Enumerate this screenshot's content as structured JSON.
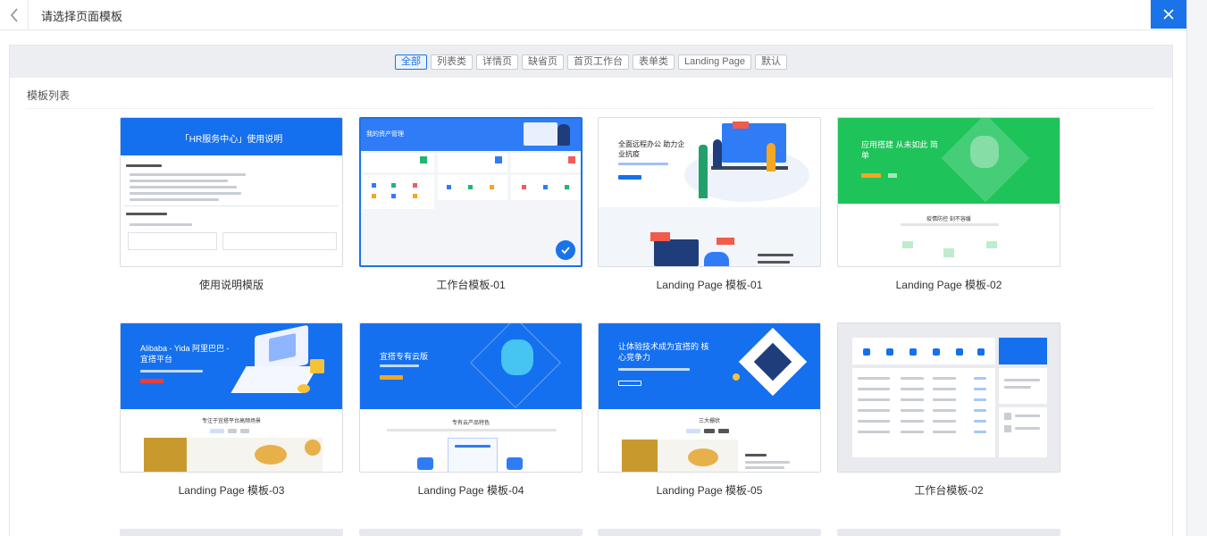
{
  "header": {
    "title": "请选择页面模板"
  },
  "tabs": [
    {
      "label": "全部",
      "active": true
    },
    {
      "label": "列表类",
      "active": false
    },
    {
      "label": "详情页",
      "active": false
    },
    {
      "label": "缺省页",
      "active": false
    },
    {
      "label": "首页工作台",
      "active": false
    },
    {
      "label": "表单类",
      "active": false
    },
    {
      "label": "Landing Page",
      "active": false
    },
    {
      "label": "默认",
      "active": false
    }
  ],
  "section": {
    "label": "模板列表"
  },
  "templates": [
    {
      "label": "使用说明模版",
      "selected": false
    },
    {
      "label": "工作台模板-01",
      "selected": true
    },
    {
      "label": "Landing Page 模板-01",
      "selected": false
    },
    {
      "label": "Landing Page 模板-02",
      "selected": false
    },
    {
      "label": "Landing Page 模板-03",
      "selected": false
    },
    {
      "label": "Landing Page 模板-04",
      "selected": false
    },
    {
      "label": "Landing Page 模板-05",
      "selected": false
    },
    {
      "label": "工作台模板-02",
      "selected": false
    }
  ],
  "thumbs": {
    "hr_title": "「HR服务中心」使用说明",
    "workbench_title": "我的资产管理",
    "lp01_title": "全面远程办公 助力企业抗疫",
    "lp02_title": "应用搭建 从未如此 简单",
    "lp02_sub": "疫情防控 刻不容缓",
    "lp03_title": "Alibaba - Yida 阿里巴巴 - 宜搭平台",
    "lp03_sub": "专注于宜搭平台高频场景",
    "lp04_title": "宜搭专有云版",
    "lp04_sub": "专有云产品特色",
    "lp05_title": "让体验技术成为宜搭的 核心竞争力",
    "lp05_sub": "三大栅状"
  },
  "colors": {
    "accent": "#1a73e8",
    "banner_blue": "#1570ef",
    "banner_green": "#1ec35a"
  },
  "icons": {
    "back": "chevron-left-icon",
    "close": "close-icon",
    "selected": "check-circle-icon"
  }
}
